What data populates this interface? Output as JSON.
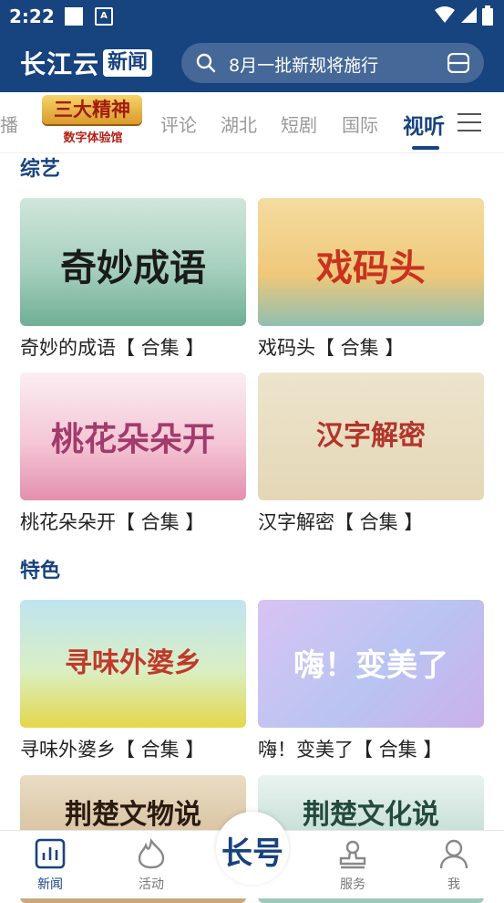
{
  "status_bar": {
    "time": "2:22"
  },
  "header": {
    "logo_main": "长江云",
    "logo_sub": "新闻",
    "search_placeholder": "8月一批新规将施行"
  },
  "badge": {
    "title": "三大精神",
    "subtitle": "数字体验馆"
  },
  "tabs": [
    {
      "label": "直播"
    },
    {
      "label": "评论"
    },
    {
      "label": "湖北"
    },
    {
      "label": "短剧"
    },
    {
      "label": "国际"
    },
    {
      "label": "视听"
    }
  ],
  "sections": [
    {
      "title": "综艺",
      "items": [
        {
          "caption": "奇妙的成语【 合集 】",
          "thumb_title": "奇妙成语"
        },
        {
          "caption": "戏码头【 合集 】",
          "thumb_title": "戏码头"
        },
        {
          "caption": "桃花朵朵开【 合集 】",
          "thumb_title": "桃花朵朵开"
        },
        {
          "caption": "汉字解密【 合集 】",
          "thumb_title": "汉字解密"
        }
      ]
    },
    {
      "title": "特色",
      "items": [
        {
          "caption": "寻味外婆乡【 合集 】",
          "thumb_title": "寻味外婆乡"
        },
        {
          "caption": "嗨！变美了【 合集 】",
          "thumb_title": "嗨！变美了"
        },
        {
          "caption": "",
          "thumb_title": "荆楚文物说"
        },
        {
          "caption": "",
          "thumb_title": "荆楚文化说"
        }
      ]
    }
  ],
  "bottom_nav": {
    "items": [
      {
        "label": "新闻"
      },
      {
        "label": "活动"
      },
      {
        "label": "服务"
      },
      {
        "label": "我"
      }
    ],
    "center_label": "长号"
  },
  "colors": {
    "brand": "#17437f",
    "active_text": "#17437f",
    "inactive_text": "#9a9a9a"
  }
}
